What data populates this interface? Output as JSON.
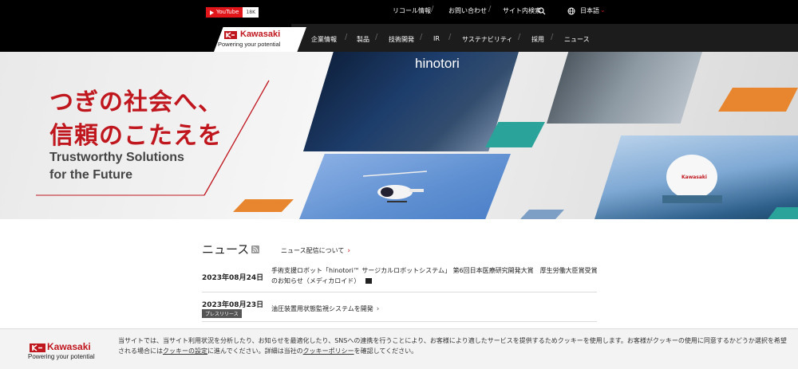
{
  "topbar": {
    "youtube_label": "YouTube",
    "youtube_count": "18K",
    "links": [
      "リコール情報",
      "お問い合わせ",
      "サイト内検索"
    ],
    "language": "日本語"
  },
  "brand": {
    "name": "Kawasaki",
    "tagline": "Powering your potential",
    "color": "#c0161e"
  },
  "nav": {
    "items": [
      "企業情報",
      "製品",
      "技術開発",
      "IR",
      "サステナビリティ",
      "採用",
      "ニュース"
    ]
  },
  "hero": {
    "title_line1": "つぎの社会へ、",
    "title_line2": "信頼のこたえを",
    "subtitle_line1": "Trustworthy Solutions",
    "subtitle_line2": "for the Future",
    "photo_label_hinotori": "hinotori",
    "photo_label_tank": "Kawasaki"
  },
  "news": {
    "heading": "ニュース",
    "feed_link": "ニュース配信について",
    "items": [
      {
        "date": "2023年08月24日",
        "text": "手術支援ロボット「hinotori™ サージカルロボットシステム」 第6回日本医療研究開発大賞　厚生労働大臣賞受賞のお知らせ（メディカロイド）",
        "badge": ""
      },
      {
        "date": "2023年08月23日",
        "text": "油圧装置用状態監視システムを開発",
        "badge": "プレスリリース"
      }
    ]
  },
  "cookie": {
    "text_part1": "当サイトでは、当サイト利用状況を分析したり、お知らせを最適化したり、SNSへの連携を行うことにより、お客様により適したサービスを提供するためクッキーを使用します。お客様がクッキーの使用に同意するかどうか選択を希望される場合には",
    "link1": "クッキーの設定",
    "text_part2": "に進んでください。詳細は当社の",
    "link2": "クッキーポリシー",
    "text_part3": "を確認してください。"
  }
}
